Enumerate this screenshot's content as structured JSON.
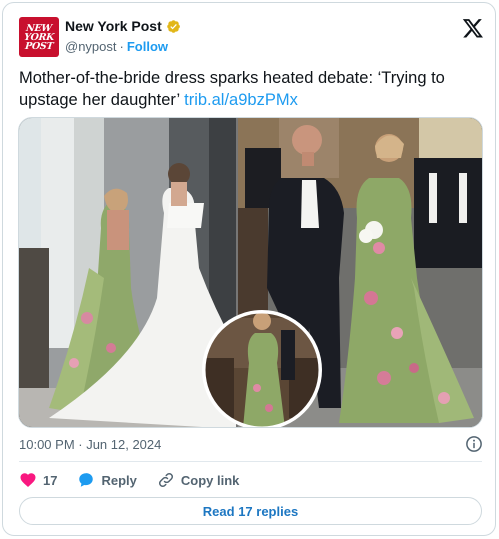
{
  "account": {
    "name": "New York Post",
    "handle": "@nypost",
    "separator": "·",
    "follow_label": "Follow",
    "avatar_lines": [
      "NEW",
      "YORK",
      "POST"
    ]
  },
  "tweet": {
    "text": "Mother-of-the-bride dress sparks heated debate: ‘Trying to upstage her daughter’ ",
    "link": "trib.al/a9bzPMx"
  },
  "media": {
    "images": [
      "bride-and-mother-photo",
      "mother-walking-aisle-photo",
      "inset-back-of-dress-photo"
    ]
  },
  "meta": {
    "timestamp": "10:00 PM · Jun 12, 2024"
  },
  "actions": {
    "like_count": "17",
    "reply_label": "Reply",
    "copy_link_label": "Copy link",
    "read_replies_label": "Read 17 replies"
  },
  "colors": {
    "accent": "#1d9bf0",
    "like": "#f91880",
    "brand": "#c8102e"
  }
}
